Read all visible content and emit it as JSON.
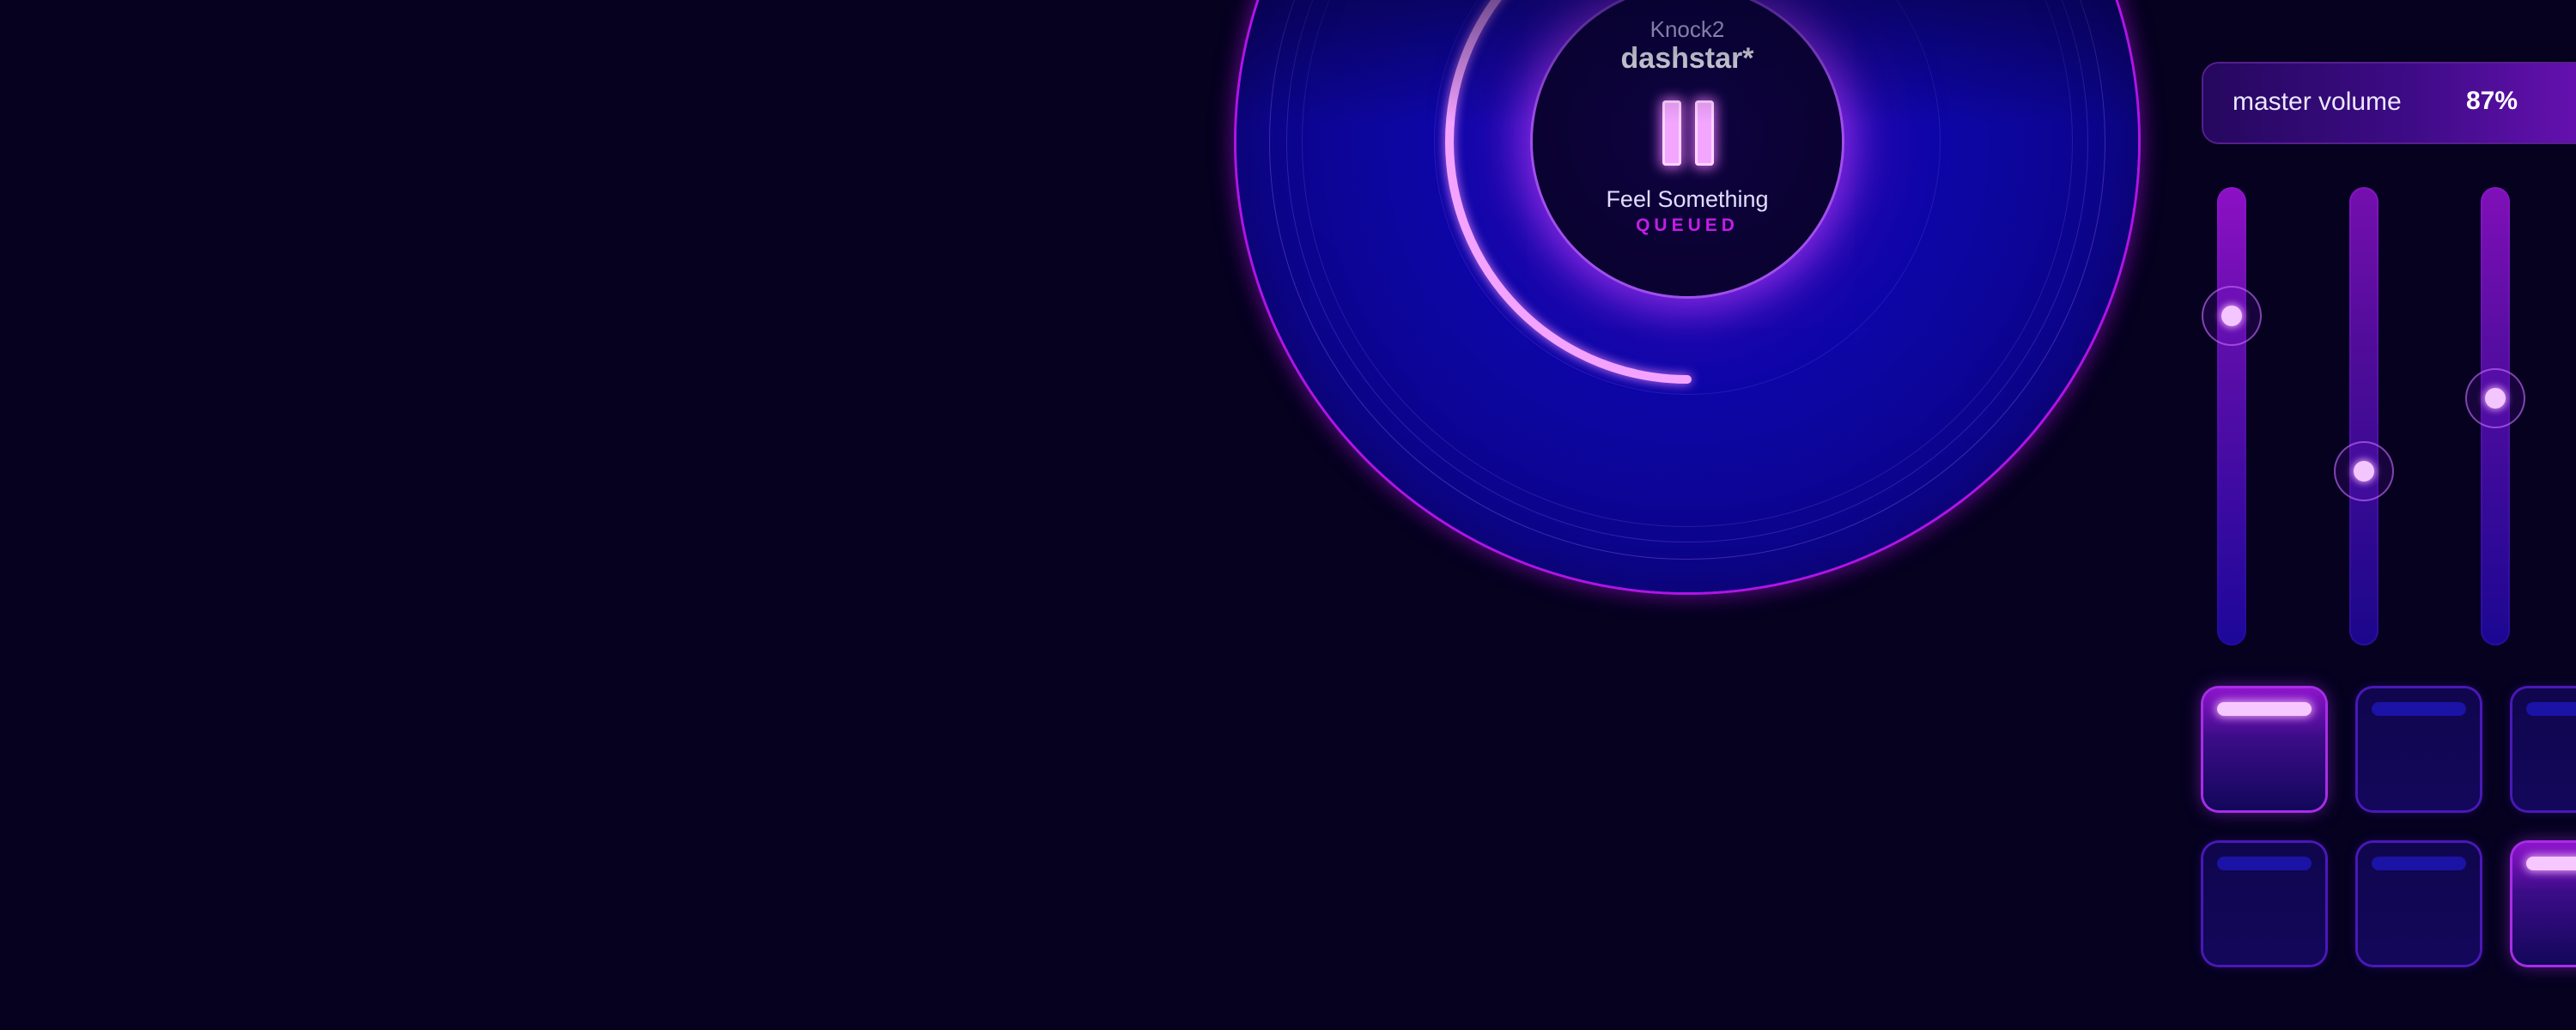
{
  "colors": {
    "background": "#05011f",
    "disc": "#0e06a8",
    "accent_magenta": "#b014e6",
    "progress_arc": "#f5a6ff",
    "queued": "#c21ee6"
  },
  "now_playing": {
    "artist": "Knock2",
    "title": "dashstar*",
    "control_icon": "pause-icon",
    "progress_fraction": 0.5
  },
  "up_next": {
    "title": "Feel Something",
    "status": "QUEUED"
  },
  "master_volume": {
    "label": "master volume",
    "value": "87%"
  },
  "sliders": [
    {
      "level": 0.72
    },
    {
      "level": 0.38
    },
    {
      "level": 0.54
    }
  ],
  "pads": [
    {
      "row": 1,
      "col": 1,
      "active": true
    },
    {
      "row": 1,
      "col": 2,
      "active": false
    },
    {
      "row": 1,
      "col": 3,
      "active": false
    },
    {
      "row": 2,
      "col": 1,
      "active": false
    },
    {
      "row": 2,
      "col": 2,
      "active": false
    },
    {
      "row": 2,
      "col": 3,
      "active": true
    }
  ]
}
